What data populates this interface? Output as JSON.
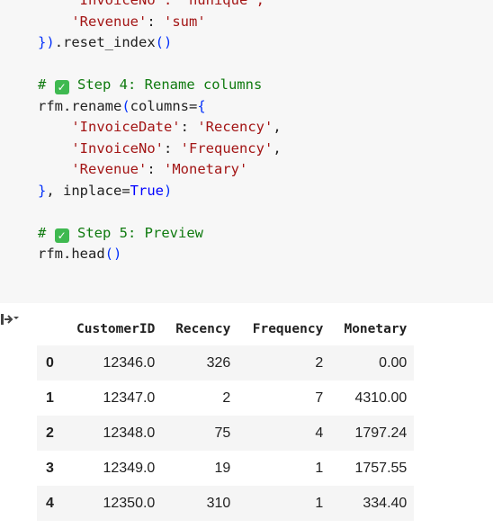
{
  "code_lines": [
    [
      {
        "t": "    'InvoiceNo': 'nunique',",
        "c": "str"
      }
    ],
    [
      {
        "t": "    ",
        "c": ""
      },
      {
        "t": "'Revenue'",
        "c": "str"
      },
      {
        "t": ": ",
        "c": ""
      },
      {
        "t": "'sum'",
        "c": "str"
      }
    ],
    [
      {
        "t": "}",
        "c": "br"
      },
      {
        "t": ")",
        "c": "br"
      },
      {
        "t": ".reset_index",
        "c": ""
      },
      {
        "t": "()",
        "c": "br"
      }
    ],
    [],
    [
      {
        "t": "# ",
        "c": "cm"
      },
      {
        "t": "✓",
        "c": "check"
      },
      {
        "t": " Step 4: Rename columns",
        "c": "cm"
      }
    ],
    [
      {
        "t": "rfm.rename",
        "c": ""
      },
      {
        "t": "(",
        "c": "br"
      },
      {
        "t": "columns=",
        "c": ""
      },
      {
        "t": "{",
        "c": "br"
      }
    ],
    [
      {
        "t": "    ",
        "c": ""
      },
      {
        "t": "'InvoiceDate'",
        "c": "str"
      },
      {
        "t": ": ",
        "c": ""
      },
      {
        "t": "'Recency'",
        "c": "str"
      },
      {
        "t": ",",
        "c": ""
      }
    ],
    [
      {
        "t": "    ",
        "c": ""
      },
      {
        "t": "'InvoiceNo'",
        "c": "str"
      },
      {
        "t": ": ",
        "c": ""
      },
      {
        "t": "'Frequency'",
        "c": "str"
      },
      {
        "t": ",",
        "c": ""
      }
    ],
    [
      {
        "t": "    ",
        "c": ""
      },
      {
        "t": "'Revenue'",
        "c": "str"
      },
      {
        "t": ": ",
        "c": ""
      },
      {
        "t": "'Monetary'",
        "c": "str"
      }
    ],
    [
      {
        "t": "}",
        "c": "br"
      },
      {
        "t": ", inplace=",
        "c": ""
      },
      {
        "t": "True",
        "c": "kw"
      },
      {
        "t": ")",
        "c": "br"
      }
    ],
    [],
    [
      {
        "t": "# ",
        "c": "cm"
      },
      {
        "t": "✓",
        "c": "check"
      },
      {
        "t": " Step 5: Preview",
        "c": "cm"
      }
    ],
    [
      {
        "t": "rfm.head",
        "c": ""
      },
      {
        "t": "()",
        "c": "br"
      }
    ]
  ],
  "output_icon": "output-expand-icon",
  "table": {
    "headers": [
      "",
      "CustomerID",
      "Recency",
      "Frequency",
      "Monetary"
    ],
    "rows": [
      [
        "0",
        "12346.0",
        "326",
        "2",
        "0.00"
      ],
      [
        "1",
        "12347.0",
        "2",
        "7",
        "4310.00"
      ],
      [
        "2",
        "12348.0",
        "75",
        "4",
        "1797.24"
      ],
      [
        "3",
        "12349.0",
        "19",
        "1",
        "1757.55"
      ],
      [
        "4",
        "12350.0",
        "310",
        "1",
        "334.40"
      ]
    ]
  }
}
